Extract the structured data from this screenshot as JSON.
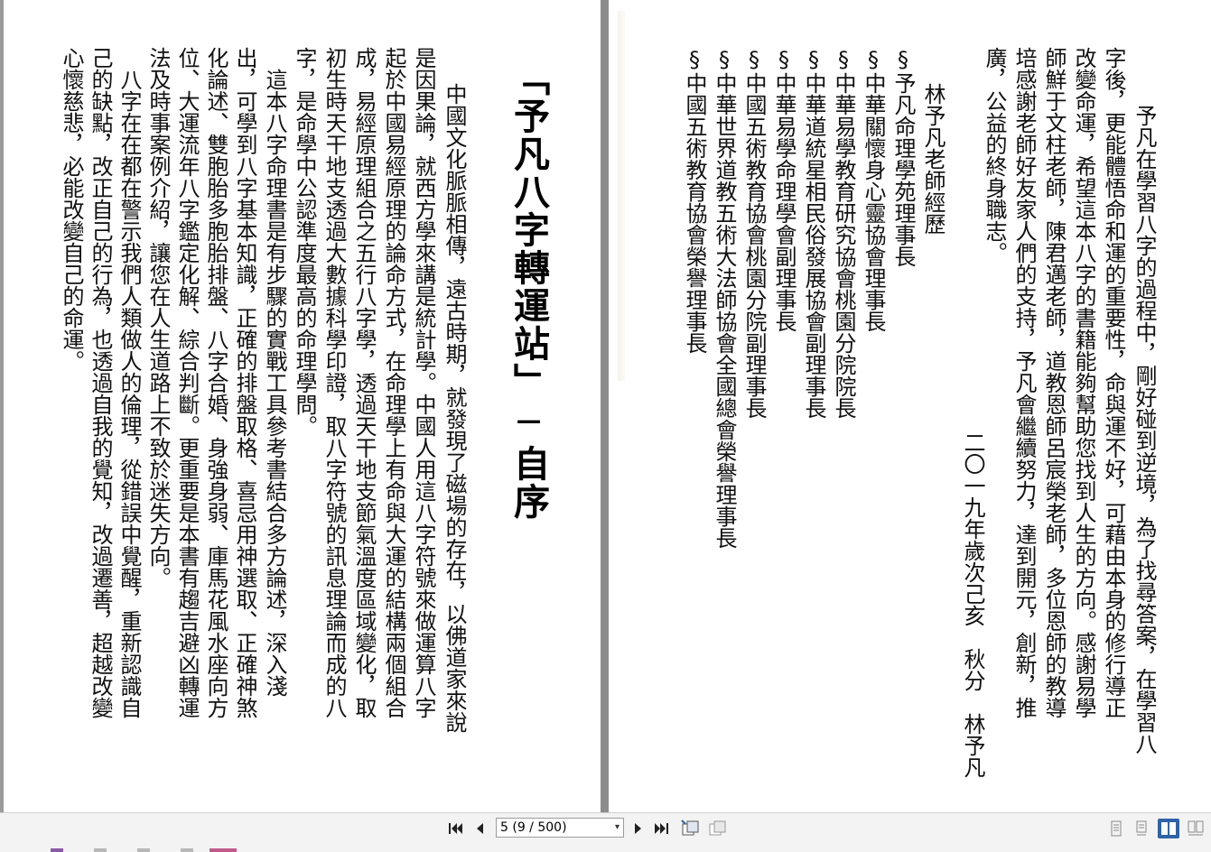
{
  "left_page": {
    "title": "「予凡八字轉運站」─自序",
    "columns": [
      "中國文化脈脈相傳，遠古時期，就發現了磁場的存在，以佛道家來說",
      "是因果論，就西方學來講是統計學。中國人用這八字符號來做運算八字",
      "起於中國易經原理的論命方式，在命理學上有命與大運的結構兩個組合",
      "成，易經原理組合之五行八字學，透過天干地支節氣溫度區域變化，取",
      "初生時天干地支透過大數據科學印證，取八字符號的訊息理論而成的八",
      "字，是命學中公認準度最高的命理學問。",
      "　這本八字命理書是有步驟的實戰工具參考書結合多方論述，深入淺",
      "出，可學到八字基本知識，正確的排盤取格、喜忌用神選取、正確神煞",
      "化論述、雙胞胎多胞胎排盤、八字合婚、身強身弱、庫馬花風水座向方",
      "位、大運流年八字鑑定化解、綜合判斷。更重要是本書有趨吉避凶轉運",
      "法及時事案例介紹，讓您在人生道路上不致於迷失方向。",
      "　八字在在都在警示我們人類做人的倫理，從錯誤中覺醒，重新認識自",
      "己的缺點，改正自己的行為，也透過自我的覺知，改過遷善，超越改變",
      "心懷慈悲，必能改變自己的命運。"
    ]
  },
  "right_page": {
    "columns": [
      "　予凡在學習八字的過程中，剛好碰到逆境，為了找尋答案，在學習八",
      "字後，更能體悟命和運的重要性，命與運不好，可藉由本身的修行導正",
      "改變命運，希望這本八字的書籍能夠幫助您找到人生的方向。感謝易學",
      "師鮮于文柱老師，陳君邁老師，道教恩師呂宸榮老師，多位恩師的教導",
      "培感謝老師好友家人們的支持，予凡會繼續努力，達到開元，創新，推",
      "廣，公益的終身職志。"
    ],
    "date_line": "二〇一九年歲次己亥　秋分　林予凡",
    "bio_heading": "林予凡老師經歷",
    "bio_items": [
      "§予凡命理學苑理事長",
      "§中華關懷身心靈協會理事長",
      "§中華易學教育研究協會桃園分院院長",
      "§中華道統星相民俗發展協會副理事長",
      "§中華易學命理學會副理事長",
      "§中國五術教育協會桃園分院副理事長",
      "§中華世界道教五術大法師協會全國總會榮譽理事長",
      "§中國五術教育協會榮譽理事長"
    ]
  },
  "toolbar": {
    "page_indicator": "5 (9 / 500)",
    "icons": [
      "first-page-icon",
      "prev-page-icon",
      "next-page-icon",
      "last-page-icon",
      "copy-page-icon",
      "paste-page-icon"
    ],
    "view_modes": [
      "single-page-icon",
      "continuous-icon",
      "two-page-icon",
      "two-page-continuous-icon"
    ],
    "active_mode": "two-page-icon",
    "accent": "#2f62a8"
  }
}
